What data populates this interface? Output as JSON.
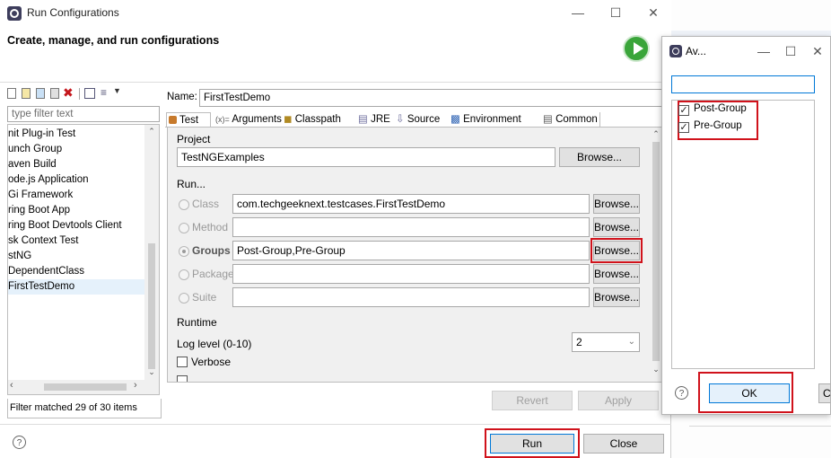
{
  "main_window": {
    "title": "Run Configurations",
    "heading": "Create, manage, and run configurations"
  },
  "left_panel": {
    "filter_placeholder": "type filter text",
    "items": [
      "nit Plug-in Test",
      "unch Group",
      "aven Build",
      "ode.js Application",
      "Gi Framework",
      "ring Boot App",
      "ring Boot Devtools Client",
      "sk Context Test",
      "stNG",
      "DependentClass",
      "FirstTestDemo"
    ],
    "status": "Filter matched 29 of 30 items"
  },
  "config": {
    "name_label": "Name:",
    "name_value": "FirstTestDemo",
    "tabs": [
      "Test",
      "Arguments",
      "Classpath",
      "JRE",
      "Source",
      "Environment",
      "Common"
    ],
    "project_label": "Project",
    "project_value": "TestNGExamples",
    "browse_label": "Browse...",
    "run_label": "Run...",
    "class_label": "Class",
    "class_value": "com.techgeeknext.testcases.FirstTestDemo",
    "method_label": "Method",
    "groups_label": "Groups",
    "groups_value": "Post-Group,Pre-Group",
    "package_label": "Package",
    "suite_label": "Suite",
    "runtime_label": "Runtime",
    "log_level_label": "Log level (0-10)",
    "log_level_value": "2",
    "verbose_label": "Verbose",
    "revert_label": "Revert",
    "apply_label": "Apply"
  },
  "footer": {
    "run_label": "Run",
    "close_label": "Close"
  },
  "dialog": {
    "title": "Av...",
    "items": [
      {
        "label": "Post-Group",
        "checked": true
      },
      {
        "label": "Pre-Group",
        "checked": true
      }
    ],
    "ok_label": "OK"
  },
  "background_partial": {
    "cut_label": "C"
  },
  "colors": {
    "highlight": "#d0121b",
    "selection": "#cce4f7",
    "run_icon": "#3aa53a"
  }
}
